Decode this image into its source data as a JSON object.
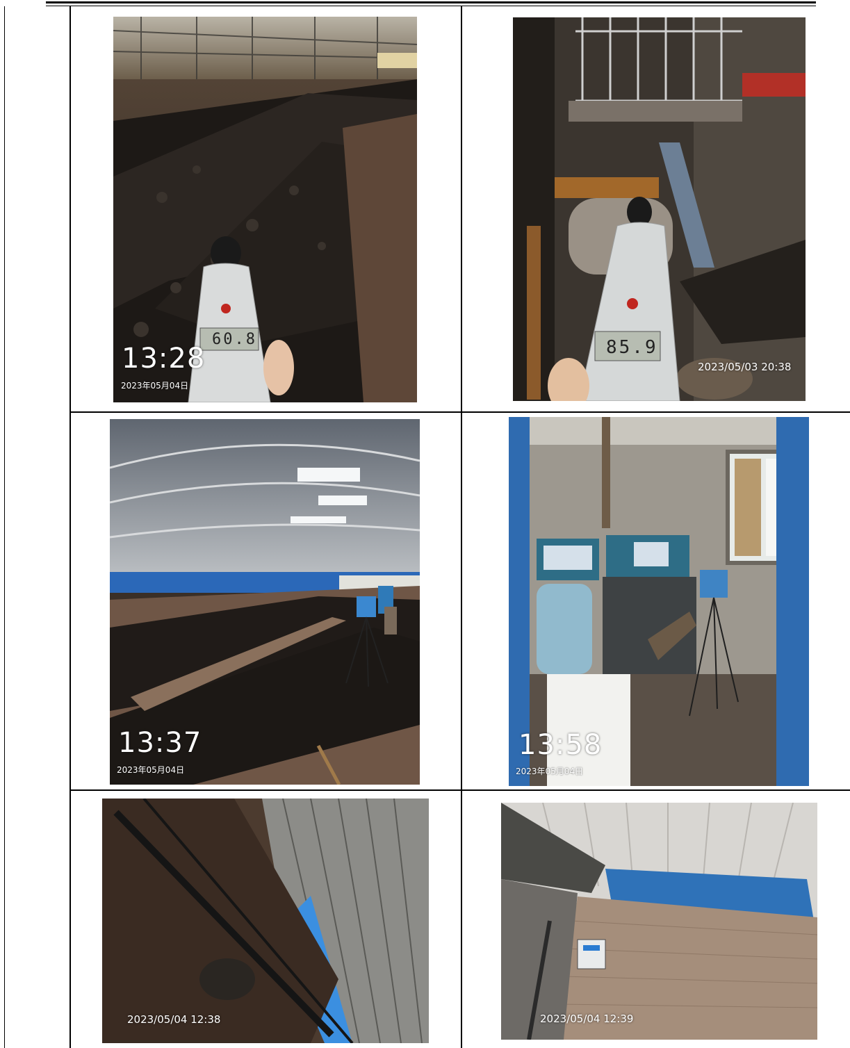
{
  "photos": [
    {
      "name": "coal-pile-noise-meter",
      "meter_reading": "60.8",
      "time": "13:28",
      "date": "2023年05月04日"
    },
    {
      "name": "crusher-motor-noise-meter",
      "meter_reading": "85.9",
      "stamp": "2023/05/03 20:38"
    },
    {
      "name": "coal-shed-sampler",
      "time": "13:37",
      "date": "2023年05月04日"
    },
    {
      "name": "control-room-sampler",
      "time": "13:58",
      "date": "2023年05月04日"
    },
    {
      "name": "conveyor-belt-shed",
      "stamp": "2023/05/04 12:38"
    },
    {
      "name": "kiln-wall-control-box",
      "stamp": "2023/05/04 12:39"
    }
  ],
  "colors": {
    "rule": "#000000",
    "timestamp_text": "#ffffff"
  }
}
